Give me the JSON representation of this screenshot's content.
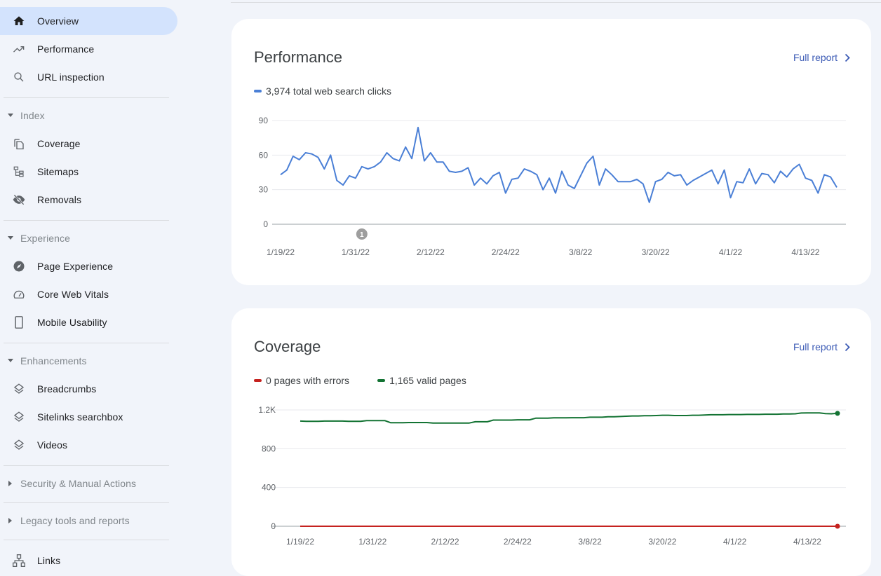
{
  "sidebar": {
    "top_items": [
      {
        "label": "Overview",
        "icon": "home-icon",
        "active": true
      },
      {
        "label": "Performance",
        "icon": "trending-up-icon",
        "active": false
      },
      {
        "label": "URL inspection",
        "icon": "search-icon",
        "active": false
      }
    ],
    "sections": [
      {
        "title": "Index",
        "expanded": true,
        "items": [
          {
            "label": "Coverage",
            "icon": "file-copy-icon"
          },
          {
            "label": "Sitemaps",
            "icon": "sitemap-icon"
          },
          {
            "label": "Removals",
            "icon": "visibility-off-icon"
          }
        ]
      },
      {
        "title": "Experience",
        "expanded": true,
        "items": [
          {
            "label": "Page Experience",
            "icon": "page-experience-icon"
          },
          {
            "label": "Core Web Vitals",
            "icon": "speed-gauge-icon"
          },
          {
            "label": "Mobile Usability",
            "icon": "smartphone-icon"
          }
        ]
      },
      {
        "title": "Enhancements",
        "expanded": true,
        "items": [
          {
            "label": "Breadcrumbs",
            "icon": "layers-icon"
          },
          {
            "label": "Sitelinks searchbox",
            "icon": "layers-icon"
          },
          {
            "label": "Videos",
            "icon": "layers-icon"
          }
        ]
      },
      {
        "title": "Security & Manual Actions",
        "expanded": false,
        "items": []
      },
      {
        "title": "Legacy tools and reports",
        "expanded": false,
        "items": []
      }
    ],
    "bottom_items": [
      {
        "label": "Links",
        "icon": "links-tree-icon"
      }
    ]
  },
  "performance": {
    "title": "Performance",
    "full_report_label": "Full report",
    "legend_label": "3,974 total web search clicks",
    "annotation_label": "1"
  },
  "coverage": {
    "title": "Coverage",
    "full_report_label": "Full report",
    "legend": [
      {
        "label": "0 pages with errors"
      },
      {
        "label": "1,165 valid pages"
      }
    ]
  },
  "chart_data": [
    {
      "type": "line",
      "title": "Performance",
      "xlabel": "",
      "ylabel": "",
      "x_start": "1/19/22",
      "x_tick_labels": [
        "1/19/22",
        "1/31/22",
        "2/12/22",
        "2/24/22",
        "3/8/22",
        "3/20/22",
        "4/1/22",
        "4/13/22"
      ],
      "x_tick_day_offsets": [
        0,
        12,
        24,
        36,
        48,
        60,
        72,
        84
      ],
      "y_tick_labels": [
        "0",
        "30",
        "60",
        "90"
      ],
      "y_ticks": [
        0,
        30,
        60,
        90
      ],
      "ylim": [
        0,
        90
      ],
      "grid": true,
      "legend_position": "top-left",
      "annotations": [
        {
          "label": "1",
          "day_offset": 13
        }
      ],
      "series": [
        {
          "name": "3,974 total web search clicks",
          "color": "#4a7fd6",
          "values": [
            43,
            47,
            59,
            56,
            62,
            61,
            58,
            48,
            60,
            38,
            34,
            42,
            40,
            50,
            48,
            50,
            54,
            62,
            57,
            55,
            67,
            57,
            84,
            55,
            62,
            54,
            54,
            46,
            45,
            46,
            49,
            34,
            40,
            35,
            42,
            45,
            27,
            39,
            40,
            48,
            46,
            43,
            30,
            40,
            27,
            46,
            34,
            31,
            42,
            53,
            59,
            34,
            48,
            43,
            37,
            37,
            37,
            39,
            35,
            19,
            37,
            39,
            45,
            42,
            43,
            34,
            38,
            41,
            44,
            47,
            35,
            47,
            23,
            37,
            36,
            48,
            35,
            44,
            43,
            36,
            46,
            41,
            48,
            52,
            40,
            38,
            27,
            43,
            41,
            32
          ]
        }
      ]
    },
    {
      "type": "line",
      "title": "Coverage",
      "xlabel": "",
      "ylabel": "",
      "x_start": "1/19/22",
      "x_tick_labels": [
        "1/19/22",
        "1/31/22",
        "2/12/22",
        "2/24/22",
        "3/8/22",
        "3/20/22",
        "4/1/22",
        "4/13/22"
      ],
      "x_tick_day_offsets": [
        0,
        12,
        24,
        36,
        48,
        60,
        72,
        84
      ],
      "y_tick_labels": [
        "0",
        "400",
        "800",
        "1.2K"
      ],
      "y_ticks": [
        0,
        400,
        800,
        1200
      ],
      "ylim": [
        0,
        1200
      ],
      "grid": true,
      "legend_position": "top-left",
      "series": [
        {
          "name": "0 pages with errors",
          "color": "#c5221f",
          "values": [
            0,
            0,
            0,
            0,
            0,
            0,
            0,
            0,
            0,
            0,
            0,
            0,
            0,
            0,
            0,
            0,
            0,
            0,
            0,
            0,
            0,
            0,
            0,
            0,
            0,
            0,
            0,
            0,
            0,
            0,
            0,
            0,
            0,
            0,
            0,
            0,
            0,
            0,
            0,
            0,
            0,
            0,
            0,
            0,
            0,
            0,
            0,
            0,
            0,
            0,
            0,
            0,
            0,
            0,
            0,
            0,
            0,
            0,
            0,
            0,
            0,
            0,
            0,
            0,
            0,
            0,
            0,
            0,
            0,
            0,
            0,
            0,
            0,
            0,
            0,
            0,
            0,
            0,
            0,
            0,
            0,
            0,
            0,
            0,
            0,
            0,
            0,
            0,
            0,
            0
          ]
        },
        {
          "name": "1,165 valid pages",
          "color": "#137333",
          "values": [
            1085,
            1082,
            1082,
            1082,
            1085,
            1085,
            1085,
            1085,
            1082,
            1082,
            1082,
            1090,
            1090,
            1090,
            1090,
            1068,
            1068,
            1068,
            1070,
            1070,
            1070,
            1070,
            1065,
            1065,
            1065,
            1065,
            1065,
            1065,
            1065,
            1078,
            1078,
            1078,
            1095,
            1095,
            1095,
            1095,
            1098,
            1098,
            1098,
            1115,
            1115,
            1115,
            1118,
            1118,
            1118,
            1120,
            1120,
            1120,
            1125,
            1125,
            1125,
            1130,
            1130,
            1132,
            1135,
            1138,
            1138,
            1140,
            1140,
            1142,
            1145,
            1145,
            1142,
            1142,
            1142,
            1145,
            1145,
            1147,
            1150,
            1150,
            1150,
            1152,
            1152,
            1152,
            1154,
            1154,
            1154,
            1156,
            1156,
            1156,
            1158,
            1158,
            1160,
            1168,
            1170,
            1170,
            1170,
            1162,
            1160,
            1165
          ]
        }
      ]
    }
  ]
}
